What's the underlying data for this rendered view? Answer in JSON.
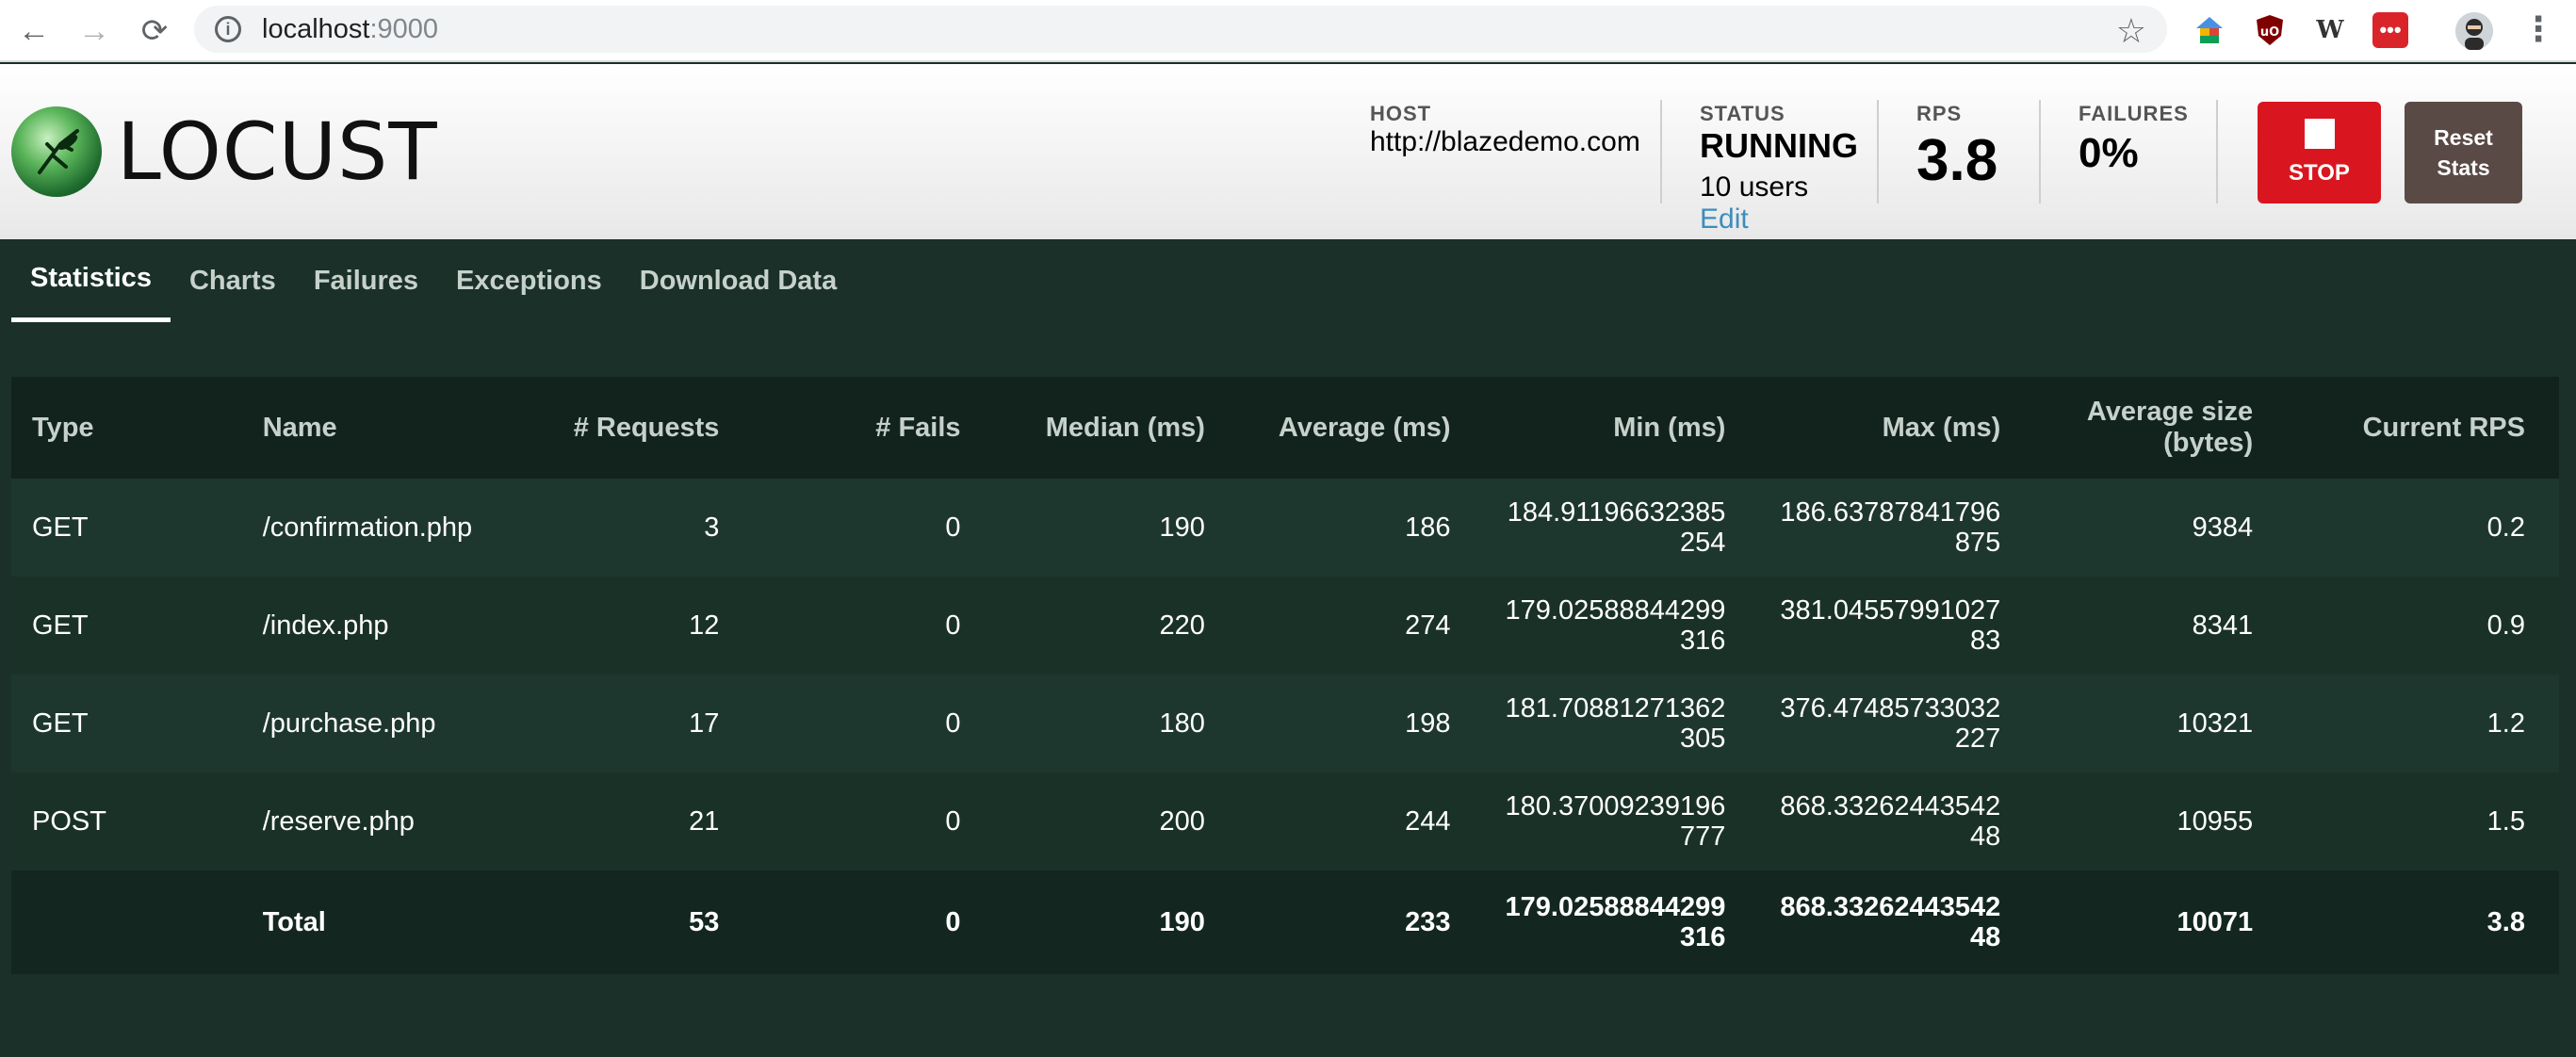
{
  "browser": {
    "url_host": "localhost",
    "url_port": ":9000",
    "nav_back": "←",
    "nav_forward": "→",
    "nav_reload": "⟳",
    "info": "i",
    "star": "☆",
    "menu": "⋮"
  },
  "app": {
    "logo_text": "LOCUST",
    "host_label": "HOST",
    "host_value": "http://blazedemo.com",
    "status_label": "STATUS",
    "status_value": "RUNNING",
    "users": "10 users",
    "edit": "Edit",
    "rps_label": "RPS",
    "rps_value": "3.8",
    "failures_label": "FAILURES",
    "failures_value": "0%",
    "stop": "STOP",
    "reset_line1": "Reset",
    "reset_line2": "Stats",
    "colors": {
      "stop": "#d9161f",
      "reset": "#5a4a46",
      "edit_link": "#3c8dbc",
      "bg": "#1a3028"
    }
  },
  "tabs": [
    "Statistics",
    "Charts",
    "Failures",
    "Exceptions",
    "Download Data"
  ],
  "table": {
    "headers": [
      "Type",
      "Name",
      "# Requests",
      "# Fails",
      "Median (ms)",
      "Average (ms)",
      "Min (ms)",
      "Max (ms)",
      "Average size (bytes)",
      "Current RPS"
    ],
    "rows": [
      {
        "type": "GET",
        "name": "/confirmation.php",
        "requests": "3",
        "fails": "0",
        "median": "190",
        "average": "186",
        "min_a": "184.91196632385",
        "min_b": "254",
        "max_a": "186.63787841796",
        "max_b": "875",
        "size": "9384",
        "rps": "0.2"
      },
      {
        "type": "GET",
        "name": "/index.php",
        "requests": "12",
        "fails": "0",
        "median": "220",
        "average": "274",
        "min_a": "179.02588844299",
        "min_b": "316",
        "max_a": "381.04557991027",
        "max_b": "83",
        "size": "8341",
        "rps": "0.9"
      },
      {
        "type": "GET",
        "name": "/purchase.php",
        "requests": "17",
        "fails": "0",
        "median": "180",
        "average": "198",
        "min_a": "181.70881271362",
        "min_b": "305",
        "max_a": "376.47485733032",
        "max_b": "227",
        "size": "10321",
        "rps": "1.2"
      },
      {
        "type": "POST",
        "name": "/reserve.php",
        "requests": "21",
        "fails": "0",
        "median": "200",
        "average": "244",
        "min_a": "180.37009239196",
        "min_b": "777",
        "max_a": "868.33262443542",
        "max_b": "48",
        "size": "10955",
        "rps": "1.5"
      }
    ],
    "total": {
      "type": "",
      "name": "Total",
      "requests": "53",
      "fails": "0",
      "median": "190",
      "average": "233",
      "min_a": "179.02588844299",
      "min_b": "316",
      "max_a": "868.33262443542",
      "max_b": "48",
      "size": "10071",
      "rps": "3.8"
    }
  }
}
